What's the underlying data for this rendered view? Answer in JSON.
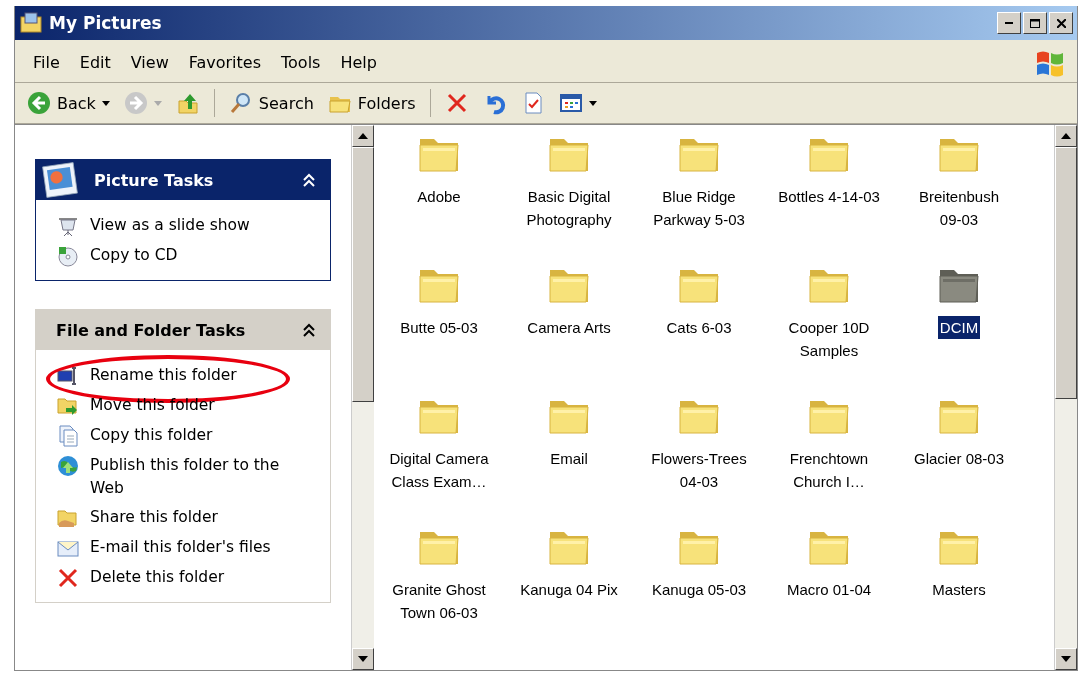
{
  "window": {
    "title": "My Pictures"
  },
  "menu": [
    {
      "label": "File"
    },
    {
      "label": "Edit"
    },
    {
      "label": "View"
    },
    {
      "label": "Favorites"
    },
    {
      "label": "Tools"
    },
    {
      "label": "Help"
    }
  ],
  "toolbar": [
    {
      "kind": "nav",
      "label": "Back",
      "disabled": false,
      "dropdown": true
    },
    {
      "kind": "nav",
      "disabled": true,
      "dropdown": true
    },
    {
      "kind": "icon"
    },
    {
      "kind": "separator"
    },
    {
      "kind": "nav",
      "label": "Search",
      "disabled": false,
      "dropdown": false
    },
    {
      "kind": "nav",
      "label": "Folders",
      "disabled": false,
      "dropdown": false
    },
    {
      "kind": "separator"
    },
    {
      "kind": "icon"
    },
    {
      "kind": "icon"
    },
    {
      "kind": "icon"
    },
    {
      "kind": "nav",
      "disabled": false,
      "dropdown": true
    }
  ],
  "task_panels": [
    {
      "title": "Picture Tasks",
      "kind": "special",
      "expanded": true,
      "tasks": [
        {
          "label": "View as a slide show",
          "circled": false
        },
        {
          "label": "Copy to CD",
          "circled": false
        }
      ]
    },
    {
      "title": "File and Folder Tasks",
      "kind": "normal",
      "expanded": true,
      "tasks": [
        {
          "label": "Rename this folder",
          "circled": true
        },
        {
          "label": "Move this folder",
          "circled": false
        },
        {
          "label": "Copy this folder",
          "circled": false
        },
        {
          "label": "Publish this folder to the Web",
          "circled": false
        },
        {
          "label": "Share this folder",
          "circled": false
        },
        {
          "label": "E-mail this folder's files",
          "circled": false
        },
        {
          "label": "Delete this folder",
          "circled": false
        }
      ]
    }
  ],
  "folders": [
    {
      "label": "Adobe",
      "selected": false
    },
    {
      "label": "Basic Digital Photography",
      "selected": false
    },
    {
      "label": "Blue Ridge Parkway 5-03",
      "selected": false
    },
    {
      "label": "Bottles 4-14-03",
      "selected": false
    },
    {
      "label": "Breitenbush 09-03",
      "selected": false
    },
    {
      "label": "Butte 05-03",
      "selected": false
    },
    {
      "label": "Camera Arts",
      "selected": false
    },
    {
      "label": "Cats 6-03",
      "selected": false
    },
    {
      "label": "Cooper 10D Samples",
      "selected": false
    },
    {
      "label": "DCIM",
      "selected": true
    },
    {
      "label": "Digital Camera Class Exam…",
      "selected": false
    },
    {
      "label": "Email",
      "selected": false
    },
    {
      "label": "Flowers-Trees 04-03",
      "selected": false
    },
    {
      "label": "Frenchtown Church I…",
      "selected": false
    },
    {
      "label": "Glacier 08-03",
      "selected": false
    },
    {
      "label": "Granite Ghost Town 06-03",
      "selected": false
    },
    {
      "label": "Kanuga 04 Pix",
      "selected": false
    },
    {
      "label": "Kanuga 05-03",
      "selected": false
    },
    {
      "label": "Macro 01-04",
      "selected": false
    },
    {
      "label": "Masters",
      "selected": false
    }
  ]
}
